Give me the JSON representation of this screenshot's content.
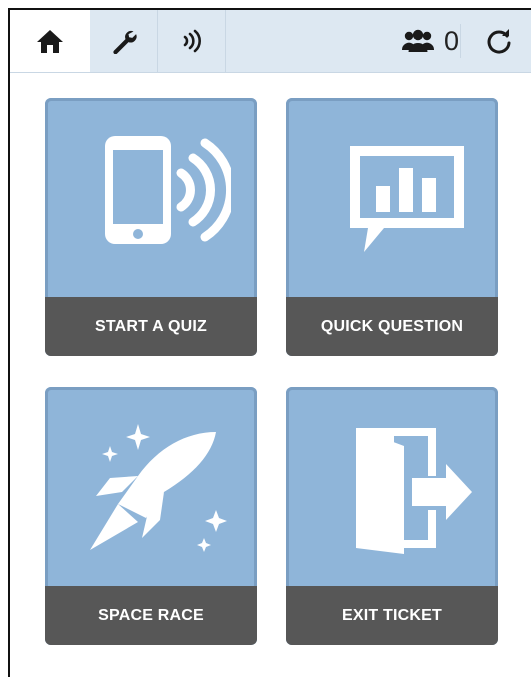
{
  "toolbar": {
    "tabs": [
      {
        "id": "home",
        "icon": "home-icon"
      },
      {
        "id": "tools",
        "icon": "wrench-icon"
      },
      {
        "id": "live",
        "icon": "broadcast-icon"
      }
    ],
    "student_count": "0",
    "students_icon": "students-icon",
    "refresh_icon": "refresh-icon"
  },
  "tiles": [
    {
      "label": "START A QUIZ",
      "icon": "phone-broadcast-icon"
    },
    {
      "label": "QUICK QUESTION",
      "icon": "chart-bubble-icon"
    },
    {
      "label": "SPACE RACE",
      "icon": "rocket-icon"
    },
    {
      "label": "EXIT TICKET",
      "icon": "exit-door-icon"
    }
  ],
  "colors": {
    "toolbar_bg": "#dde8f2",
    "tile_bg": "#8fb5d9",
    "tile_label_bg": "#575757",
    "tile_border": "#7a9ec2"
  }
}
